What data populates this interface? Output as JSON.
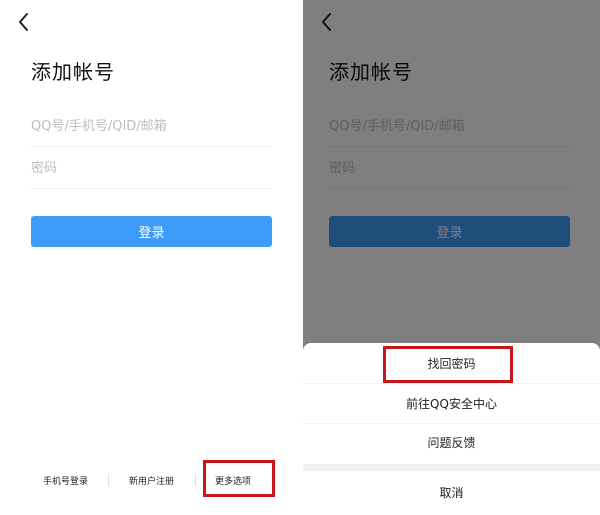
{
  "left": {
    "title": "添加帐号",
    "account_placeholder": "QQ号/手机号/QID/邮箱",
    "password_placeholder": "密码",
    "login_label": "登录",
    "bottom": {
      "phone_login": "手机号登录",
      "register": "新用户注册",
      "more_options": "更多选项"
    }
  },
  "right": {
    "title": "添加帐号",
    "account_placeholder": "QQ号/手机号/QID/邮箱",
    "password_placeholder": "密码",
    "login_label": "登录",
    "sheet": {
      "items": [
        "找回密码",
        "前往QQ安全中心",
        "问题反馈"
      ],
      "cancel": "取消"
    }
  },
  "colors": {
    "primary": "#3e9bf7",
    "highlight": "#c8161d"
  }
}
